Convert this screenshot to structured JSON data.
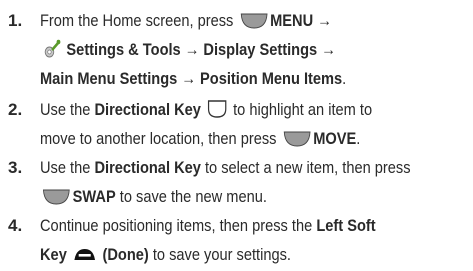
{
  "steps": [
    {
      "number": "1.",
      "lines": [
        {
          "t1": "From the Home screen, press ",
          "b1": "MENU →"
        },
        {
          "b1": "Settings & Tools → Display Settings →"
        },
        {
          "b1": "Main Menu Settings → Position Menu Items",
          "t2": "."
        }
      ]
    },
    {
      "number": "2.",
      "lines": [
        {
          "t1": "Use the ",
          "b1": "Directional Key",
          "t2": " to highlight an item to"
        },
        {
          "t1": "move to another location, then press ",
          "b1": "MOVE",
          "t2": "."
        }
      ]
    },
    {
      "number": "3.",
      "lines": [
        {
          "t1": "Use the ",
          "b1": "Directional Key",
          "t2": " to select a new item, then press"
        },
        {
          "b1": "SWAP",
          "t2": " to save the new menu."
        }
      ]
    },
    {
      "number": "4.",
      "lines": [
        {
          "t1": "Continue positioning items, then press the ",
          "b1": "Left Soft"
        },
        {
          "b1": "Key",
          "b2": "(Done)",
          "t2": " to save your settings."
        }
      ]
    }
  ],
  "icons": {
    "menu_key": "menu-key-icon",
    "settings_tools": "settings-tools-icon",
    "directional_key": "directional-key-icon",
    "move_key": "move-key-icon",
    "swap_key": "swap-key-icon",
    "left_soft_key": "left-soft-key-icon"
  },
  "colors": {
    "text": "#2a2a2a",
    "key_fill": "#9a9a9a",
    "key_outline": "#444444",
    "soft_key_fill": "#111111",
    "wrench_green": "#5a9a2a"
  }
}
